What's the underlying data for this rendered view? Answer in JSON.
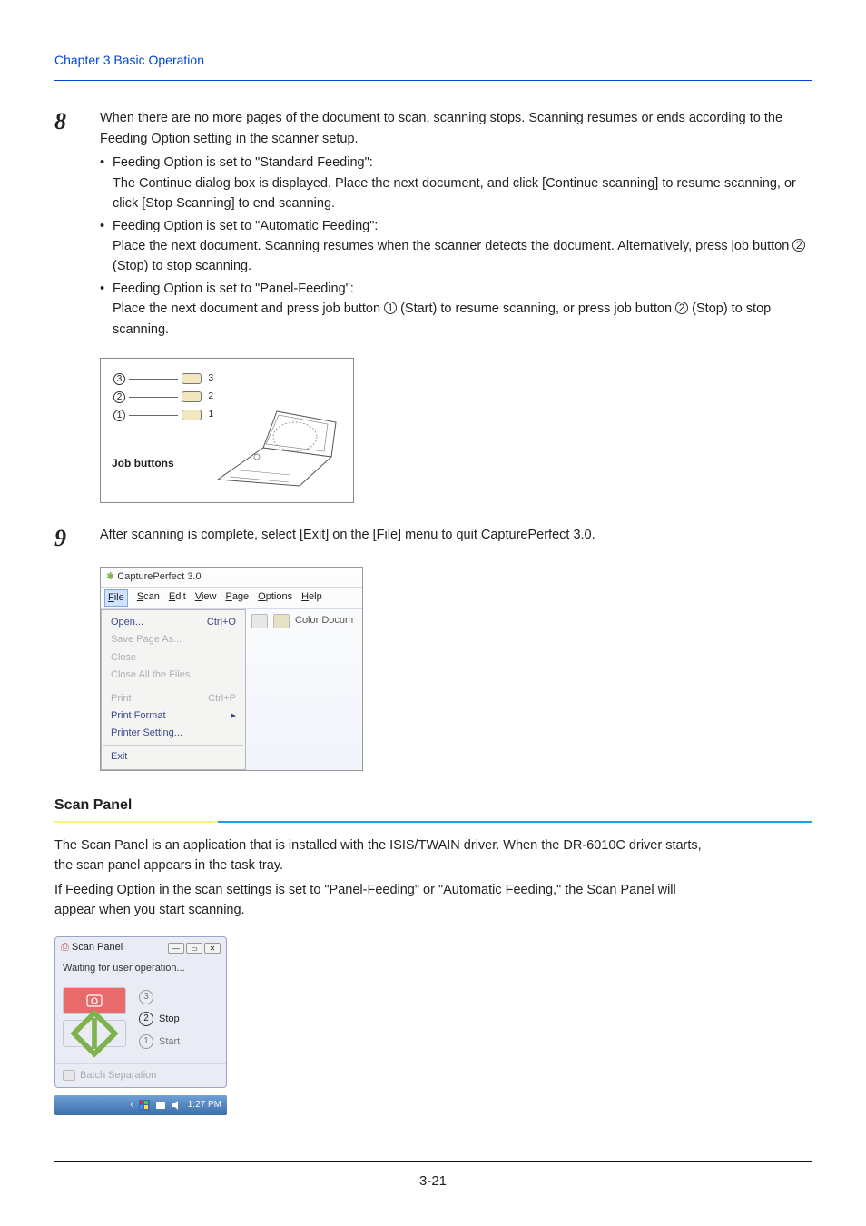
{
  "header": {
    "chapter": "Chapter 3    Basic Operation"
  },
  "step8": {
    "num": "8",
    "intro": "When there are no more pages of the document to scan, scanning stops. Scanning resumes or ends according to the Feeding Option setting in the scanner setup.",
    "b1_title": "Feeding Option is set to \"Standard Feeding\":",
    "b1_body": "The Continue dialog box is displayed. Place the next document, and click [Continue scanning] to resume scanning, or click [Stop Scanning] to end scanning.",
    "b2_title": "Feeding Option is set to \"Automatic Feeding\":",
    "b2_body1": "Place the next document. Scanning resumes when the scanner detects the document. Alternatively, press job button ",
    "b2_body2": " (Stop) to stop scanning.",
    "b3_title": "Feeding Option is set to \"Panel-Feeding\":",
    "b3_body1": "Place the next document and press job button ",
    "b3_body2": " (Start) to resume scanning, or press job button ",
    "b3_body3": " (Stop) to stop scanning.",
    "diagram": {
      "job_buttons_label": "Job buttons",
      "n3": "3",
      "n2": "2",
      "n1": "1",
      "l3": "3",
      "l2": "2",
      "l1": "1"
    }
  },
  "step9": {
    "num": "9",
    "text": "After scanning is complete, select [Exit] on the [File] menu to quit CapturePerfect 3.0.",
    "capwin": {
      "title": "CapturePerfect 3.0",
      "menubar": {
        "file": "File",
        "scan": "Scan",
        "edit": "Edit",
        "view": "View",
        "page": "Page",
        "options": "Options",
        "help": "Help"
      },
      "items": {
        "open": "Open...",
        "open_k": "Ctrl+O",
        "savepageas": "Save Page As...",
        "close": "Close",
        "closeall": "Close All the Files",
        "print": "Print",
        "print_k": "Ctrl+P",
        "printformat": "Print Format",
        "printersetting": "Printer Setting...",
        "exit": "Exit"
      },
      "right_label": "Color Docum"
    }
  },
  "scanpanel": {
    "heading": "Scan Panel",
    "p1": "The Scan Panel is an application that is installed with the ISIS/TWAIN driver. When the DR-6010C driver starts, the scan panel appears in the task tray.",
    "p2": "If Feeding Option in the scan settings is set to \"Panel-Feeding\" or \"Automatic Feeding,\" the Scan Panel will appear when you start scanning.",
    "window": {
      "title": "Scan Panel",
      "status": "Waiting for user operation...",
      "n3": "3",
      "n2": "2",
      "n2_label": "Stop",
      "n1": "1",
      "n1_label": "Start",
      "batch_sep": "Batch Separation"
    },
    "tray_time": "1:27 PM"
  },
  "page_number": "3-21"
}
